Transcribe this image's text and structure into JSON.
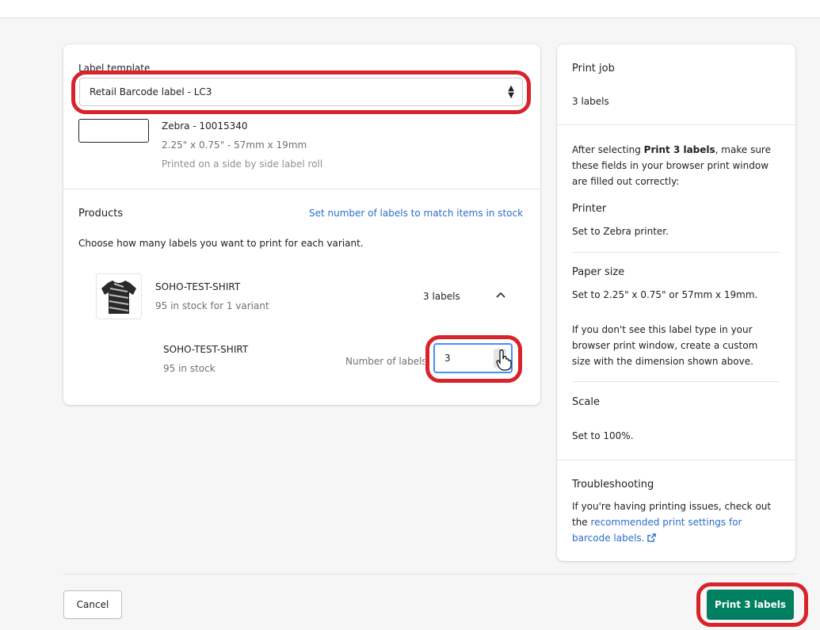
{
  "template_section": {
    "label": "Label template",
    "selected": "Retail Barcode label - LC3",
    "printer_model": "Zebra - 10015340",
    "dimensions": "2.25\" x 0.75\" - 57mm x 19mm",
    "roll_note": "Printed on a side by side label roll"
  },
  "products_section": {
    "title": "Products",
    "match_stock_link": "Set number of labels to match items in stock",
    "instructions": "Choose how many labels you want to print for each variant.",
    "product": {
      "name": "SOHO-TEST-SHIRT",
      "stock_summary": "95 in stock for 1 variant",
      "label_count": "3 labels",
      "variant": {
        "name": "SOHO-TEST-SHIRT",
        "stock": "95 in stock",
        "field_label": "Number of labels",
        "quantity": "3"
      }
    }
  },
  "print_job": {
    "title": "Print job",
    "count": "3 labels",
    "instructions_prefix": "After selecting ",
    "instructions_bold": "Print 3 labels",
    "instructions_suffix": ", make sure these fields in your browser print window are filled out correctly:",
    "printer_title": "Printer",
    "printer_value": "Set to Zebra printer.",
    "paper_title": "Paper size",
    "paper_value": "Set to 2.25\" x 0.75\" or 57mm x 19mm.",
    "paper_note": "If you don't see this label type in your browser print window, create a custom size with the dimension shown above.",
    "scale_title": "Scale",
    "scale_value": "Set to 100%.",
    "trouble_title": "Troubleshooting",
    "trouble_text": "If you're having printing issues, check out the ",
    "trouble_link": "recommended print settings for barcode labels.",
    "external_icon": "external-link-icon"
  },
  "footer": {
    "cancel_label": "Cancel",
    "print_label": "Print 3 labels"
  },
  "colors": {
    "primary": "#008060",
    "link": "#2c6ecb",
    "highlight": "#d8232a",
    "focus": "#458fff"
  }
}
